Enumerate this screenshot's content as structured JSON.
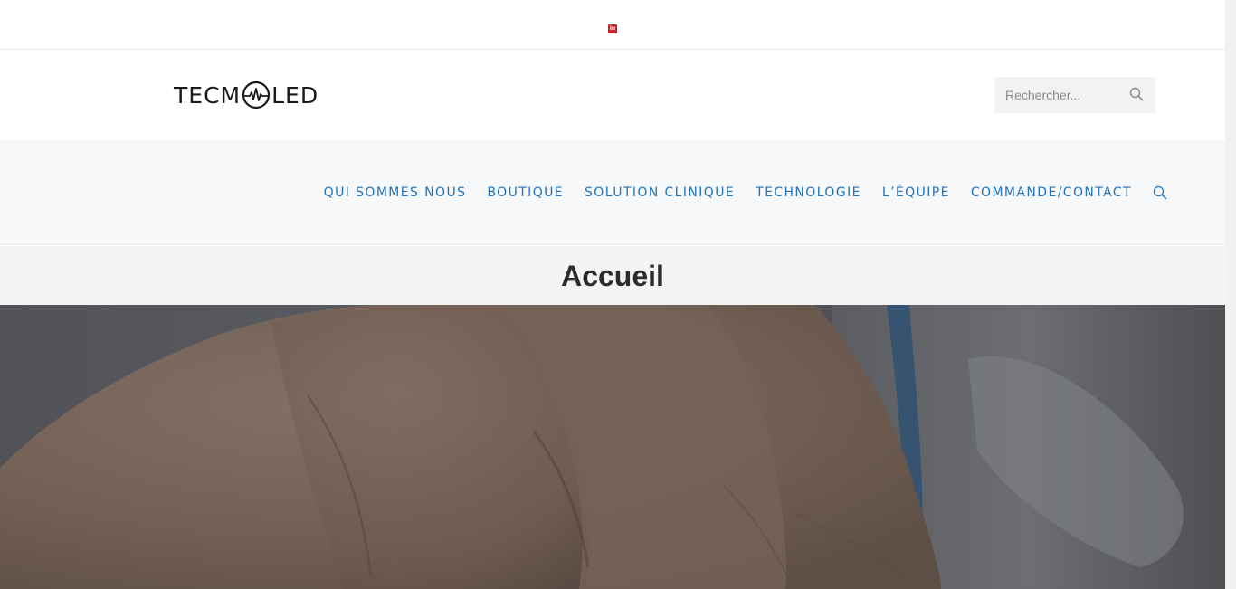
{
  "topbar": {
    "social_icon": "linkedin-icon",
    "social_color": "#c1272d",
    "social_glyph": "in"
  },
  "header": {
    "logo_left": "TECM",
    "logo_right": "LED",
    "logo_mark_icon": "heartbeat-circle-icon",
    "search": {
      "placeholder": "Rechercher...",
      "value": "",
      "icon": "search-icon"
    }
  },
  "nav": {
    "items": [
      {
        "label": "QUI SOMMES NOUS"
      },
      {
        "label": "BOUTIQUE"
      },
      {
        "label": "SOLUTION CLINIQUE"
      },
      {
        "label": "TECHNOLOGIE"
      },
      {
        "label": "L’ÉQUIPE"
      },
      {
        "label": "COMMANDE/CONTACT"
      }
    ],
    "search_icon": "search-icon",
    "link_color": "#1e73be"
  },
  "page": {
    "title": "Accueil"
  },
  "hero": {
    "image": "hand-photo"
  }
}
